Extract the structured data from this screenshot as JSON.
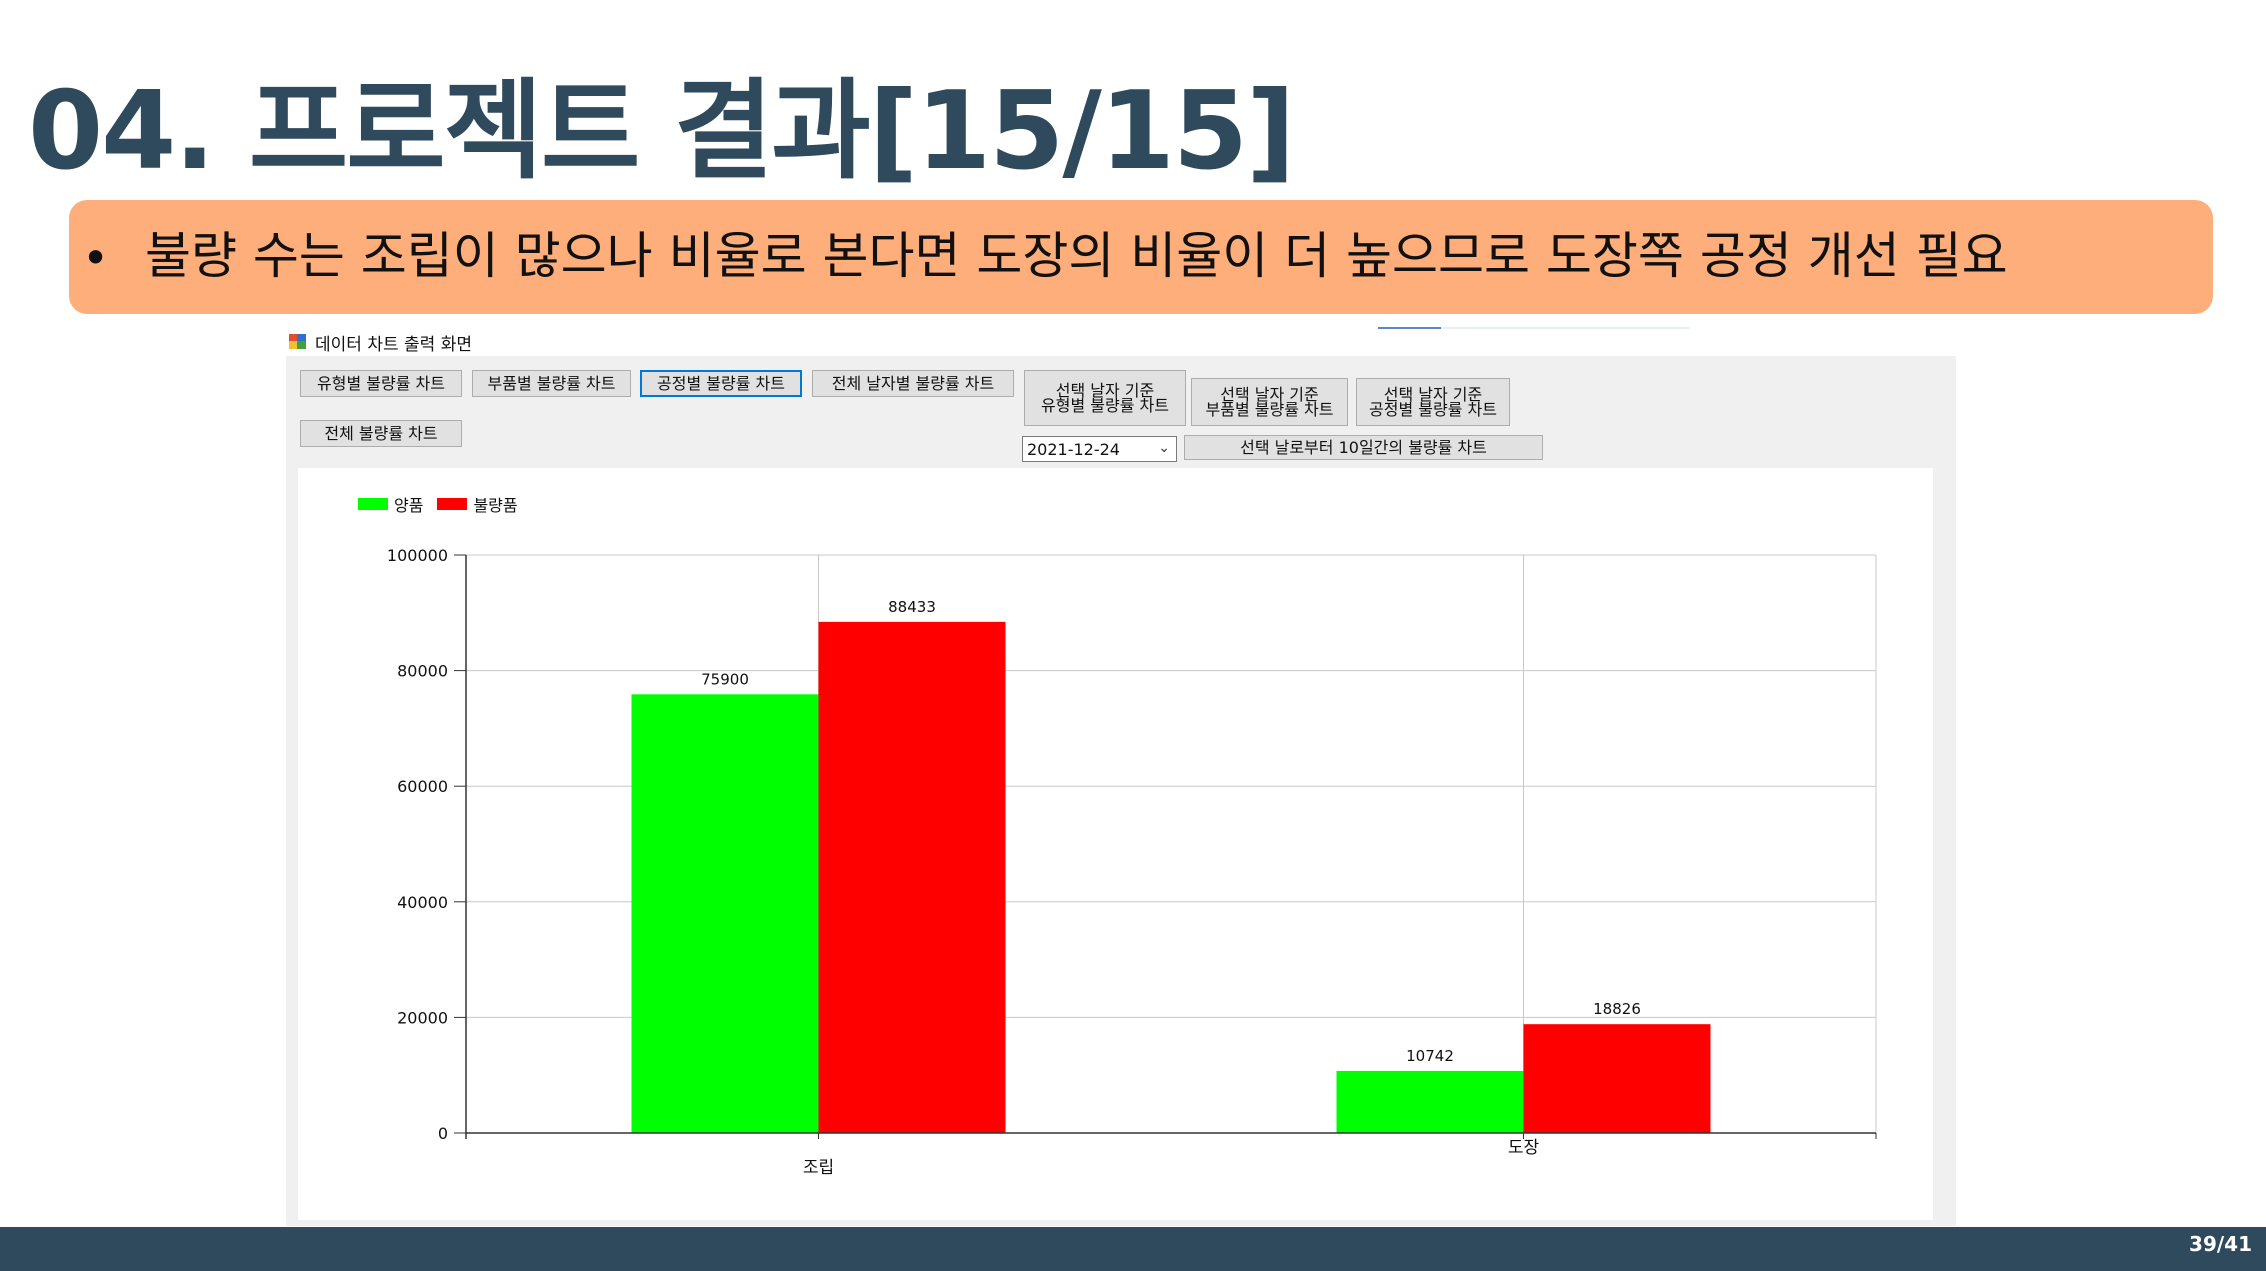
{
  "slide": {
    "title": "04. 프로젝트 결과[15/15]",
    "bullet": "•",
    "callout_text": "불량 수는 조립이 많으나 비율로 본다면 도장의 비율이 더 높으므로 도장쪽 공정 개선 필요",
    "page_number": "39/41"
  },
  "window": {
    "title": "데이터 차트 출력 화면",
    "buttons": {
      "type_chart": "유형별 불량률 차트",
      "part_chart": "부품별 불량률 차트",
      "process_chart": "공정별 불량률 차트",
      "all_date_chart": "전체 날자별 불량률 차트",
      "total_chart": "전체 불량률 차트",
      "sel_type_line1": "선택 날자 기준",
      "sel_type_line2": "유형별 불량률 차트",
      "sel_part_line1": "선택 날자 기준",
      "sel_part_line2": "부품별 불량률 차트",
      "sel_process_line1": "선택 날자 기준",
      "sel_process_line2": "공정별 불량률 차트",
      "ten_day_chart": "선택 날로부터 10일간의 불량률 차트"
    },
    "date_value": "2021-12-24"
  },
  "chart_data": {
    "type": "bar",
    "categories": [
      "조립",
      "도장"
    ],
    "series": [
      {
        "name": "양품",
        "color": "#00ff00",
        "values": [
          75900,
          10742
        ]
      },
      {
        "name": "불량품",
        "color": "#ff0000",
        "values": [
          88433,
          18826
        ]
      }
    ],
    "ylim": [
      0,
      100000
    ],
    "yticks": [
      "0",
      "20000",
      "40000",
      "60000",
      "80000",
      "100000"
    ],
    "data_labels": [
      "75900",
      "10742",
      "88433",
      "18826"
    ],
    "grid": true,
    "legend": "top-left"
  }
}
